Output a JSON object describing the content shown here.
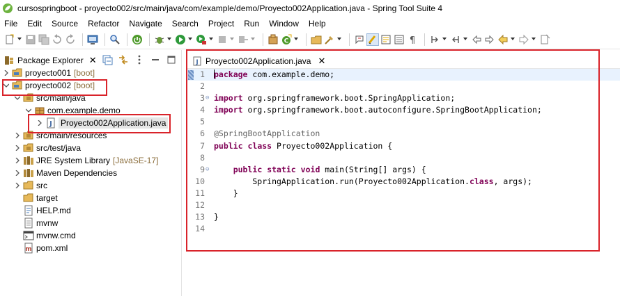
{
  "window": {
    "title": "cursospringboot - proyecto002/src/main/java/com/example/demo/Proyecto002Application.java - Spring Tool Suite 4"
  },
  "menu": {
    "items": [
      {
        "name": "menu-file",
        "label": "File"
      },
      {
        "name": "menu-edit",
        "label": "Edit"
      },
      {
        "name": "menu-source",
        "label": "Source"
      },
      {
        "name": "menu-refactor",
        "label": "Refactor"
      },
      {
        "name": "menu-navigate",
        "label": "Navigate"
      },
      {
        "name": "menu-search",
        "label": "Search"
      },
      {
        "name": "menu-project",
        "label": "Project"
      },
      {
        "name": "menu-run",
        "label": "Run"
      },
      {
        "name": "menu-window",
        "label": "Window"
      },
      {
        "name": "menu-help",
        "label": "Help"
      }
    ]
  },
  "explorer": {
    "title": "Package Explorer",
    "close_glyph": "✕",
    "rows": [
      {
        "name": "tree-proyecto001",
        "label": "proyecto001",
        "decoration": "[boot]",
        "icon": "project-folder-icon",
        "twisty": "collapsed",
        "indent": 0
      },
      {
        "name": "tree-proyecto002",
        "label": "proyecto002",
        "decoration": "[boot]",
        "icon": "project-folder-icon",
        "twisty": "expanded",
        "indent": 0
      },
      {
        "name": "tree-src-main-java",
        "label": "src/main/java",
        "decoration": "",
        "icon": "source-folder-icon",
        "twisty": "expanded",
        "indent": 1
      },
      {
        "name": "tree-package-com-example-demo",
        "label": "com.example.demo",
        "decoration": "",
        "icon": "package-icon",
        "twisty": "expanded",
        "indent": 2
      },
      {
        "name": "tree-proyecto002application-java",
        "label": "Proyecto002Application.java",
        "decoration": "",
        "icon": "java-file-icon",
        "twisty": "collapsed",
        "indent": 3,
        "selected": true
      },
      {
        "name": "tree-src-main-resources",
        "label": "src/main/resources",
        "decoration": "",
        "icon": "source-folder-icon",
        "twisty": "collapsed",
        "indent": 1
      },
      {
        "name": "tree-src-test-java",
        "label": "src/test/java",
        "decoration": "",
        "icon": "source-folder-icon",
        "twisty": "collapsed",
        "indent": 1
      },
      {
        "name": "tree-jre-system-library",
        "label": "JRE System Library",
        "decoration": "[JavaSE-17]",
        "icon": "library-icon",
        "twisty": "collapsed",
        "indent": 1
      },
      {
        "name": "tree-maven-dependencies",
        "label": "Maven Dependencies",
        "decoration": "",
        "icon": "library-icon",
        "twisty": "collapsed",
        "indent": 1
      },
      {
        "name": "tree-src",
        "label": "src",
        "decoration": "",
        "icon": "folder-icon",
        "twisty": "collapsed",
        "indent": 1
      },
      {
        "name": "tree-target",
        "label": "target",
        "decoration": "",
        "icon": "folder-icon",
        "twisty": "none",
        "indent": 1
      },
      {
        "name": "tree-help-md",
        "label": "HELP.md",
        "decoration": "",
        "icon": "markdown-file-icon",
        "twisty": "none",
        "indent": 1
      },
      {
        "name": "tree-mvnw",
        "label": "mvnw",
        "decoration": "",
        "icon": "text-file-icon",
        "twisty": "none",
        "indent": 1
      },
      {
        "name": "tree-mvnw-cmd",
        "label": "mvnw.cmd",
        "decoration": "",
        "icon": "cmd-file-icon",
        "twisty": "none",
        "indent": 1
      },
      {
        "name": "tree-pom-xml",
        "label": "pom.xml",
        "decoration": "",
        "icon": "maven-pom-icon",
        "twisty": "none",
        "indent": 1
      }
    ]
  },
  "editor": {
    "tab_label": "Proyecto002Application.java",
    "close_glyph": "✕",
    "lines": [
      {
        "n": "1",
        "fold": "",
        "tokens": [
          [
            "kw",
            "package"
          ],
          [
            "t",
            " com.example.demo;"
          ]
        ],
        "current": true
      },
      {
        "n": "2",
        "fold": "",
        "tokens": []
      },
      {
        "n": "3",
        "fold": "⊖",
        "tokens": [
          [
            "kw",
            "import"
          ],
          [
            "t",
            " org.springframework.boot.SpringApplication;"
          ]
        ]
      },
      {
        "n": "4",
        "fold": "",
        "tokens": [
          [
            "kw",
            "import"
          ],
          [
            "t",
            " org.springframework.boot.autoconfigure.SpringBootApplication;"
          ]
        ]
      },
      {
        "n": "5",
        "fold": "",
        "tokens": []
      },
      {
        "n": "6",
        "fold": "",
        "tokens": [
          [
            "ann",
            "@SpringBootApplication"
          ]
        ]
      },
      {
        "n": "7",
        "fold": "",
        "tokens": [
          [
            "kw",
            "public"
          ],
          [
            "t",
            " "
          ],
          [
            "kw",
            "class"
          ],
          [
            "t",
            " Proyecto002Application {"
          ]
        ]
      },
      {
        "n": "8",
        "fold": "",
        "tokens": []
      },
      {
        "n": "9",
        "fold": "⊖",
        "tokens": [
          [
            "t",
            "    "
          ],
          [
            "kw",
            "public"
          ],
          [
            "t",
            " "
          ],
          [
            "kw",
            "static"
          ],
          [
            "t",
            " "
          ],
          [
            "kw",
            "void"
          ],
          [
            "t",
            " main(String[] args) {"
          ]
        ]
      },
      {
        "n": "10",
        "fold": "",
        "tokens": [
          [
            "t",
            "        SpringApplication.run(Proyecto002Application."
          ],
          [
            "kw",
            "class"
          ],
          [
            "t",
            ", args);"
          ]
        ]
      },
      {
        "n": "11",
        "fold": "",
        "tokens": [
          [
            "t",
            "    }"
          ]
        ]
      },
      {
        "n": "12",
        "fold": "",
        "tokens": []
      },
      {
        "n": "13",
        "fold": "",
        "tokens": [
          [
            "t",
            "}"
          ]
        ]
      },
      {
        "n": "14",
        "fold": "",
        "tokens": []
      }
    ]
  },
  "colors": {
    "highlight_box": "#d9232a",
    "keyword": "#7f0055",
    "annotation": "#646464",
    "decoration": "#8a6d3b",
    "current_line": "#e8f2fe"
  }
}
